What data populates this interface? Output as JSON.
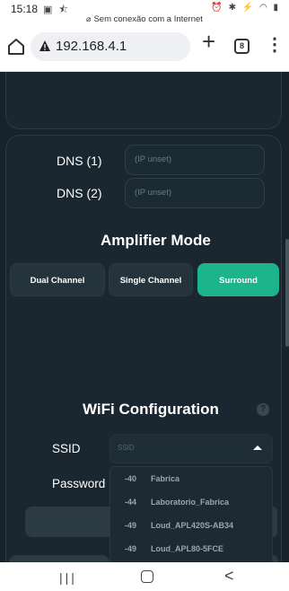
{
  "status_bar": {
    "time": "15:18",
    "left_icons": "▣ ⯪",
    "right_icons": "⏰ ✱ ⚡ ◠ ▮",
    "network_icon": "⌀",
    "network_text": "Sem conexão com a Internet"
  },
  "browser": {
    "url": "192.168.4.1",
    "new_tab_label": "+",
    "tab_count": "8",
    "menu_label": "⋮"
  },
  "dns": {
    "dns1_label": "DNS (1)",
    "dns1_placeholder": "(IP unset)",
    "dns2_label": "DNS (2)",
    "dns2_placeholder": "(IP unset)"
  },
  "amplifier": {
    "title": "Amplifier Mode",
    "modes": [
      "Dual Channel",
      "Single Channel",
      "Surround"
    ],
    "selected": "Surround"
  },
  "wifi": {
    "title": "WiFi Configuration",
    "help_label": "?",
    "ssid_label": "SSID",
    "ssid_placeholder": "SSID",
    "password_label": "Password",
    "networks": [
      {
        "rssi": "-40",
        "name": "Fabrica"
      },
      {
        "rssi": "-44",
        "name": "Laboratorio_Fabrica"
      },
      {
        "rssi": "-49",
        "name": "Loud_APL420S-AB34"
      },
      {
        "rssi": "-49",
        "name": "Loud_APL80-5FCE"
      }
    ]
  },
  "nav": {
    "recents_label": "|||",
    "back_label": "<"
  },
  "colors": {
    "background": "#17222a",
    "card": "#1a2730",
    "accent": "#1db48c"
  }
}
